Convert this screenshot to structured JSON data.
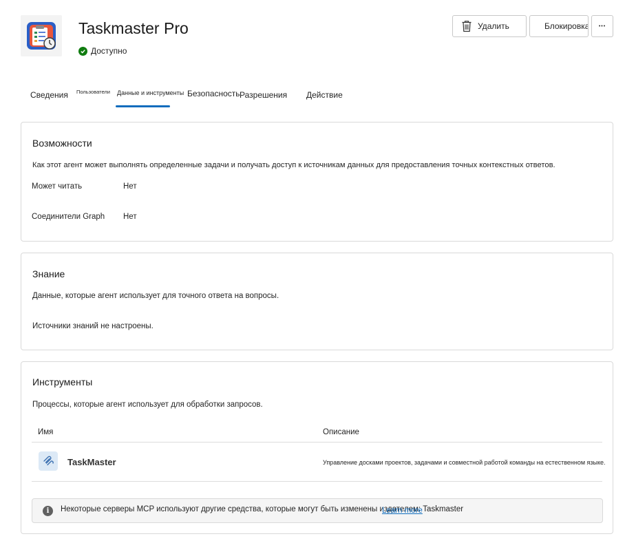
{
  "header": {
    "title": "Taskmaster Pro",
    "status": "Доступно",
    "delete_label": "Удалить",
    "block_label": "Блокировка",
    "more_label": "•••"
  },
  "tabs": [
    {
      "label": "Сведения"
    },
    {
      "label": "Пользователи"
    },
    {
      "label": "Данные и инструменты"
    },
    {
      "label": "Безопасность"
    },
    {
      "label": "Разрешения"
    },
    {
      "label": "Действие"
    }
  ],
  "capabilities": {
    "title": "Возможности",
    "description": "Как этот агент может выполнять определенные задачи и получать доступ к источникам данных для предоставления точных контекстных ответов.",
    "rows": [
      {
        "key": "Может читать",
        "value": "Нет"
      },
      {
        "key": "Соединители Graph",
        "value": "Нет"
      }
    ]
  },
  "knowledge": {
    "title": "Знание",
    "description": "Данные, которые агент использует для точного ответа на вопросы.",
    "empty_text": "Источники знаний не настроены."
  },
  "tools": {
    "title": "Инструменты",
    "description": "Процессы, которые агент использует для обработки запросов.",
    "col_name": "Имя",
    "col_desc": "Описание",
    "rows": [
      {
        "name": "TaskMaster",
        "description": "Управление досками проектов, задачами и совместной работой команды на естественном языке."
      }
    ],
    "notice_text": "Некоторые серверы MCP используют другие средства, которые могут быть изменены издателем: Taskmaster",
    "notice_link": "Learn more"
  },
  "colors": {
    "accent": "#0f6cbd",
    "success": "#107c10"
  }
}
